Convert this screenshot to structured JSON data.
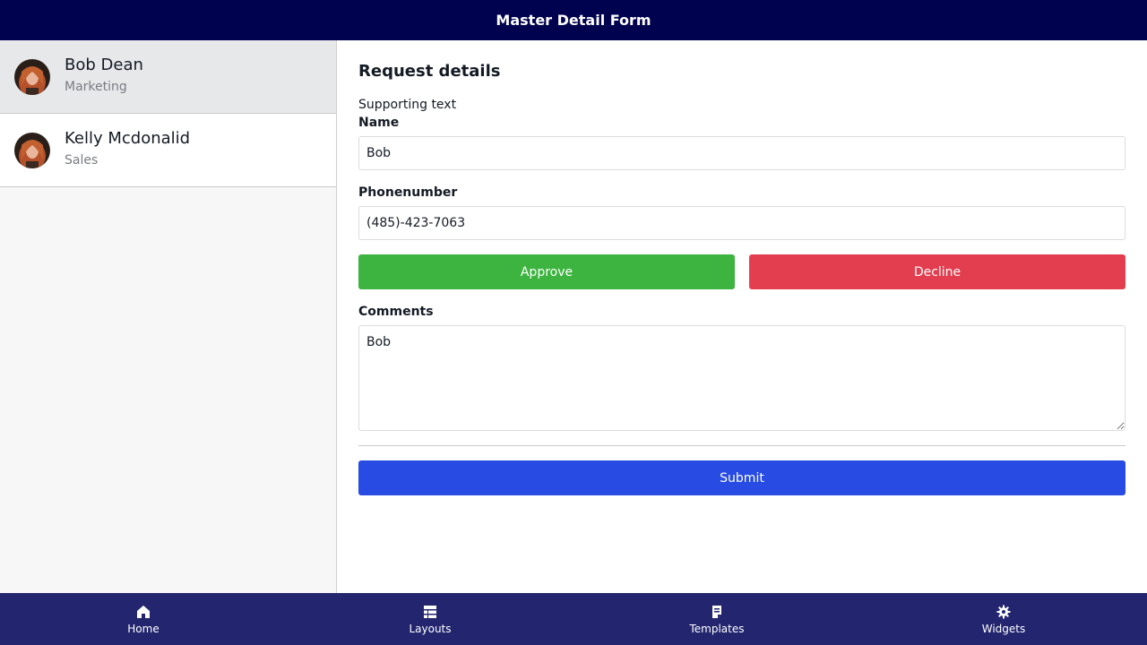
{
  "header": {
    "title": "Master Detail Form"
  },
  "sidebar": {
    "items": [
      {
        "name": "Bob Dean",
        "department": "Marketing",
        "selected": true
      },
      {
        "name": "Kelly Mcdonalid",
        "department": "Sales",
        "selected": false
      }
    ]
  },
  "detail": {
    "title": "Request details",
    "supporting_text": "Supporting text",
    "name_label": "Name",
    "name_value": "Bob",
    "phone_label": "Phonenumber",
    "phone_value": "(485)-423-7063",
    "approve_label": "Approve",
    "decline_label": "Decline",
    "comments_label": "Comments",
    "comments_value": "Bob",
    "submit_label": "Submit"
  },
  "bottom_nav": {
    "items": [
      {
        "label": "Home",
        "icon": "home-icon"
      },
      {
        "label": "Layouts",
        "icon": "layouts-icon"
      },
      {
        "label": "Templates",
        "icon": "templates-icon"
      },
      {
        "label": "Widgets",
        "icon": "gear-icon"
      }
    ]
  },
  "colors": {
    "header_bg": "#01024f",
    "nav_bg": "#23256f",
    "approve": "#3cb43f",
    "decline": "#e33e4f",
    "submit": "#284ce3",
    "selected_row": "#e7e8ea"
  }
}
